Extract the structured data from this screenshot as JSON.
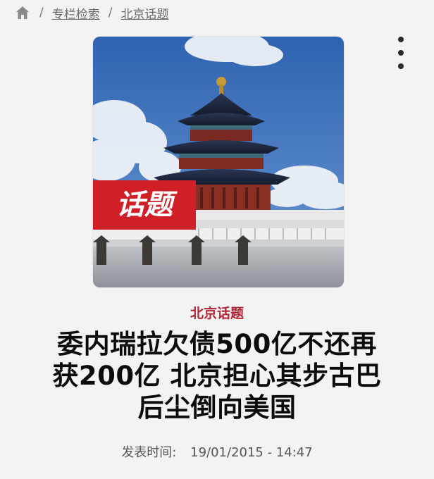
{
  "breadcrumb": {
    "home_icon": "home-icon",
    "separator": "/",
    "items": [
      {
        "label": "专栏检索"
      },
      {
        "label": "北京话题"
      }
    ]
  },
  "more_icon": "vertical-ellipsis-icon",
  "hero": {
    "banner_text": "话题",
    "banner_color": "#d01f26",
    "subject": "temple-of-heaven-photo"
  },
  "article": {
    "category": "北京话题",
    "category_color": "#b22435",
    "title_lines": [
      "委内瑞拉欠债500亿不还再",
      "获200亿 北京担心其步古巴",
      "后尘倒向美国"
    ],
    "publish_label": "发表时间:",
    "publish_time": "19/01/2015 - 14:47"
  }
}
